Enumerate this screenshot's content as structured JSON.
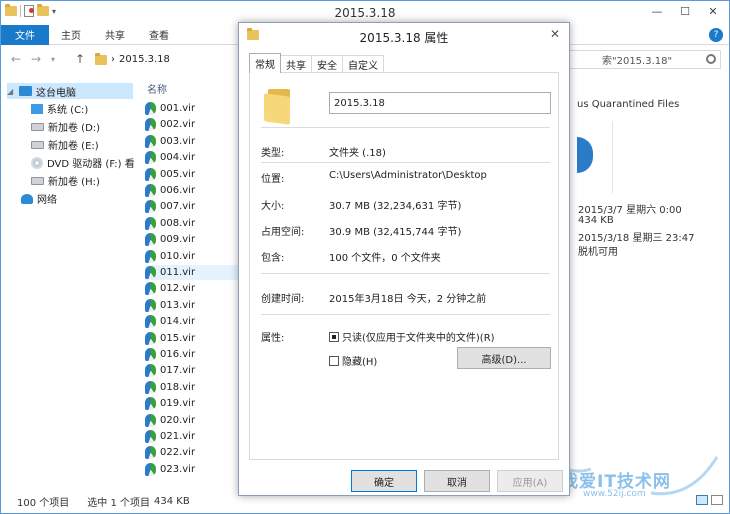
{
  "explorer": {
    "title": "2015.3.18",
    "window_buttons": {
      "minimize": "—",
      "maximize": "☐",
      "close": "✕"
    },
    "ribbon_tabs": [
      "文件",
      "主页",
      "共享",
      "查看"
    ],
    "help": "?",
    "address": {
      "separator": "›",
      "path": "2015.3.18"
    },
    "search_placeholder": "索\"2015.3.18\"",
    "nav_items": [
      {
        "label": "这台电脑",
        "icon": "computer-icon"
      },
      {
        "label": "系统 (C:)",
        "icon": "windows-drive-icon"
      },
      {
        "label": "新加卷 (D:)",
        "icon": "drive-icon"
      },
      {
        "label": "新加卷 (E:)",
        "icon": "drive-icon"
      },
      {
        "label": "DVD 驱动器 (F:) 看",
        "icon": "dvd-icon"
      },
      {
        "label": "新加卷 (H:)",
        "icon": "drive-icon"
      },
      {
        "label": "网络",
        "icon": "network-icon"
      }
    ],
    "column_header": "名称",
    "files": [
      "001.vir",
      "002.vir",
      "003.vir",
      "004.vir",
      "005.vir",
      "006.vir",
      "007.vir",
      "008.vir",
      "009.vir",
      "010.vir",
      "011.vir",
      "012.vir",
      "013.vir",
      "014.vir",
      "015.vir",
      "016.vir",
      "017.vir",
      "018.vir",
      "019.vir",
      "020.vir",
      "021.vir",
      "022.vir",
      "023.vir"
    ],
    "details": {
      "title": "us Quarantined Files",
      "lines": [
        "2015/3/7 星期六 0:00",
        "434 KB",
        "2015/3/18 星期三 23:47",
        "脱机可用"
      ]
    },
    "status": {
      "count": "100 个项目",
      "selected": "选中 1 个项目",
      "size": "434 KB"
    }
  },
  "dialog": {
    "title": "2015.3.18 属性",
    "close": "✕",
    "tabs": [
      "常规",
      "共享",
      "安全",
      "自定义"
    ],
    "name_value": "2015.3.18",
    "properties": [
      {
        "label": "类型:",
        "value": "文件夹 (.18)"
      },
      {
        "label": "位置:",
        "value": "C:\\Users\\Administrator\\Desktop"
      },
      {
        "label": "大小:",
        "value": "30.7 MB (32,234,631 字节)"
      },
      {
        "label": "占用空间:",
        "value": "30.9 MB (32,415,744 字节)"
      },
      {
        "label": "包含:",
        "value": "100 个文件，0 个文件夹"
      }
    ],
    "created": {
      "label": "创建时间:",
      "value": "2015年3月18日 今天，2 分钟之前"
    },
    "attributes": {
      "label": "属性:",
      "readonly": "只读(仅应用于文件夹中的文件)(R)",
      "hidden": "隐藏(H)",
      "advanced": "高级(D)..."
    },
    "buttons": {
      "ok": "确定",
      "cancel": "取消",
      "apply": "应用(A)"
    }
  },
  "watermark": {
    "text": "我爱IT技术网",
    "url": "www.52ij.com"
  }
}
